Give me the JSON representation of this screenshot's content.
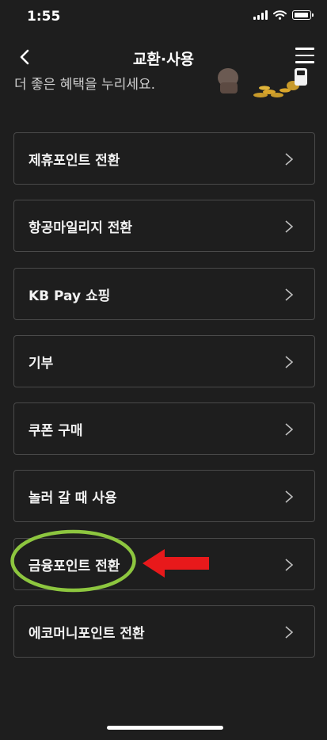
{
  "status_bar": {
    "time": "1:55",
    "icons": [
      "signal-icon",
      "wifi-icon",
      "battery-icon"
    ]
  },
  "header": {
    "title": "교환·사용",
    "back_icon": "chevron-left-icon",
    "menu_icon": "hamburger-menu-icon"
  },
  "banner": {
    "text": "더 좋은 혜택을 누리세요."
  },
  "menu": {
    "items": [
      {
        "label": "제휴포인트 전환"
      },
      {
        "label": "항공마일리지 전환"
      },
      {
        "label": "KB Pay 쇼핑"
      },
      {
        "label": "기부"
      },
      {
        "label": "쿠폰 구매"
      },
      {
        "label": "놀러 갈 때 사용"
      },
      {
        "label": "금융포인트 전환"
      },
      {
        "label": "에코머니포인트 전환"
      }
    ]
  },
  "annotations": {
    "highlighted_item": "금융포인트 전환",
    "ellipse_color": "#8dc63f",
    "arrow_color": "#e8191b"
  },
  "colors": {
    "background": "#1e1e1e",
    "item_border": "#4a4a4a",
    "text": "#f2f2f2"
  }
}
